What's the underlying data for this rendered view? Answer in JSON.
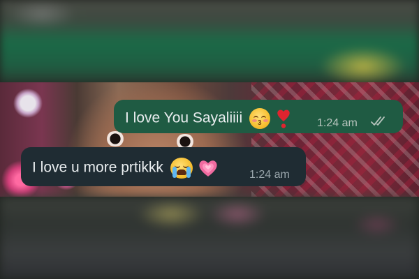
{
  "conversation": {
    "messages": [
      {
        "direction": "outgoing",
        "text": "I love You Sayaliiii",
        "emojis": [
          "kissing-face-closed-eyes",
          "red-heart-exclamation"
        ],
        "time": "1:24 am",
        "status_icon": "double-check-icon"
      },
      {
        "direction": "incoming",
        "text": "I love u more prtikkk",
        "emojis": [
          "loudly-crying-face",
          "growing-heart"
        ],
        "time": "1:24 am"
      }
    ]
  },
  "colors": {
    "outgoing_bubble": "#1f5b43",
    "incoming_bubble": "#1f2c33",
    "message_text": "#e9edef",
    "timestamp": "#b7c4bd"
  }
}
